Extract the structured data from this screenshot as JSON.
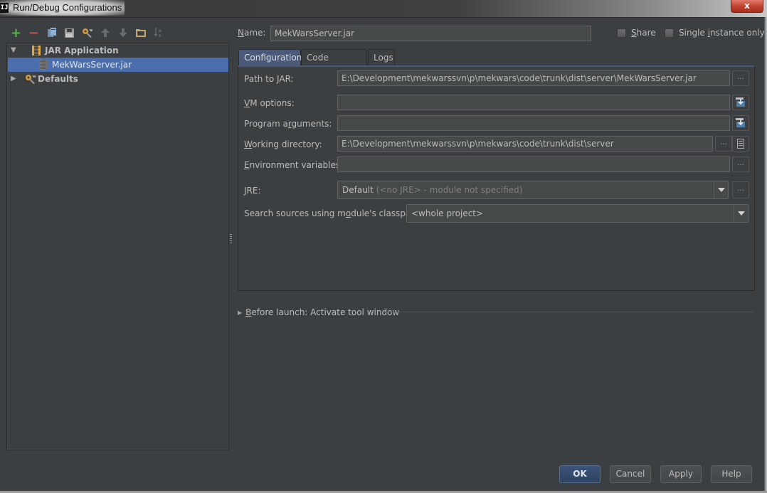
{
  "window": {
    "app_icon_label": "IJ",
    "title": "Run/Debug Configurations",
    "close_label": "x"
  },
  "toolbar": {
    "icons": [
      "add-icon",
      "remove-icon",
      "copy-icon",
      "save-icon",
      "edit-defaults-icon",
      "move-up-icon",
      "move-down-icon",
      "folder-icon",
      "sort-icon"
    ],
    "add_glyph": "+",
    "remove_glyph": "−",
    "up_glyph": "🡑",
    "down_glyph": "🡓"
  },
  "tree": {
    "items": [
      {
        "label": "JAR Application",
        "expanded": true,
        "level": 0,
        "bold": true
      },
      {
        "label": "MekWarsServer.jar",
        "level": 1,
        "selected": true
      },
      {
        "label": "Defaults",
        "expanded": false,
        "level": 0,
        "bold": true
      }
    ],
    "expanded_arrow": "▼",
    "collapsed_arrow": "▶"
  },
  "header": {
    "name_label_mnemonic": "N",
    "name_label_rest": "ame:",
    "name_value": "MekWarsServer.jar",
    "share_label_mnemonic": "S",
    "share_label_rest": "hare",
    "share_checked": false,
    "single_label_pre": "Single ",
    "single_label_mnemonic": "i",
    "single_label_rest": "nstance only",
    "single_checked": false
  },
  "tabs": [
    {
      "label": "Configuration",
      "active": true
    },
    {
      "label": "Code Coverage",
      "active": false
    },
    {
      "label": "Logs",
      "active": false
    }
  ],
  "form": {
    "path_to_jar": {
      "label_pre": "Path to ",
      "label_mnemonic": "J",
      "label_rest": "AR:",
      "value": "E:\\Development\\mekwarssvn\\p\\mekwars\\code\\trunk\\dist\\server\\MekWarsServer.jar"
    },
    "vm_options": {
      "label_mnemonic": "V",
      "label_rest": "M options:",
      "value": ""
    },
    "program_arguments": {
      "label_pre": "Program a",
      "label_mnemonic": "r",
      "label_rest": "guments:",
      "value": ""
    },
    "working_directory": {
      "label_mnemonic": "W",
      "label_rest": "orking directory:",
      "value": "E:\\Development\\mekwarssvn\\p\\mekwars\\code\\trunk\\dist\\server"
    },
    "environment_variables": {
      "label_mnemonic": "E",
      "label_rest": "nvironment variables:",
      "value": ""
    },
    "jre": {
      "label_mnemonic": "J",
      "label_rest": "RE:",
      "value": "Default",
      "hint": "(<no JRE> - module not specified)"
    },
    "search_sources": {
      "label_pre": "Search sources using m",
      "label_mnemonic": "o",
      "label_rest": "dule's classpath:",
      "value": "<whole project>"
    },
    "ellipsis": "..."
  },
  "before_launch": {
    "label_mnemonic": "B",
    "label_rest": "efore launch: Activate tool window",
    "arrow": "▶"
  },
  "buttons": {
    "ok": "OK",
    "cancel": "Cancel",
    "apply": "Apply",
    "help": "Help"
  },
  "colors": {
    "background": "#3c3f41",
    "selection": "#4b6eaf",
    "active_tab": "#4a5a78",
    "add_green": "#4fb543",
    "remove_red": "#c75450",
    "folder_tan": "#c9a76a"
  }
}
